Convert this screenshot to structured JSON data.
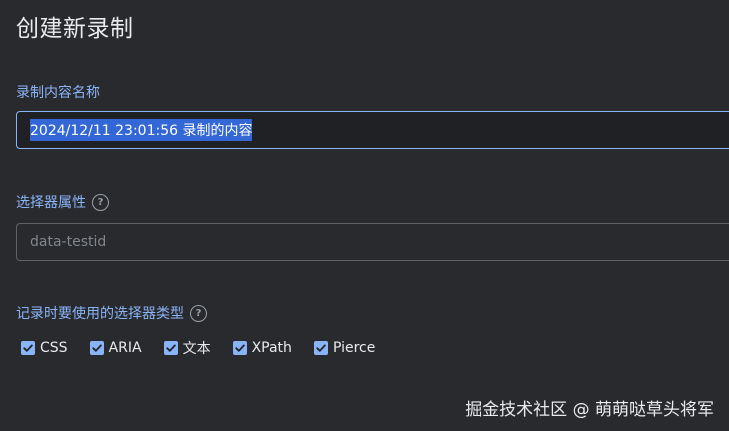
{
  "page": {
    "title": "创建新录制"
  },
  "recording_name": {
    "label": "录制内容名称",
    "value": "2024/12/11 23:01:56 录制的内容"
  },
  "selector_attribute": {
    "label": "选择器属性",
    "placeholder": "data-testid"
  },
  "selector_types": {
    "label": "记录时要使用的选择器类型",
    "options": [
      {
        "label": "CSS",
        "checked": true
      },
      {
        "label": "ARIA",
        "checked": true
      },
      {
        "label": "文本",
        "checked": true
      },
      {
        "label": "XPath",
        "checked": true
      },
      {
        "label": "Pierce",
        "checked": true
      }
    ]
  },
  "watermark": {
    "text": "掘金技术社区 @ 萌萌哒草头将军"
  },
  "colors": {
    "background": "#292a2d",
    "accent": "#8ab4f8",
    "selection": "#3367d6"
  },
  "icons": {
    "help": "help-circle-icon",
    "check": "checkmark-icon"
  }
}
